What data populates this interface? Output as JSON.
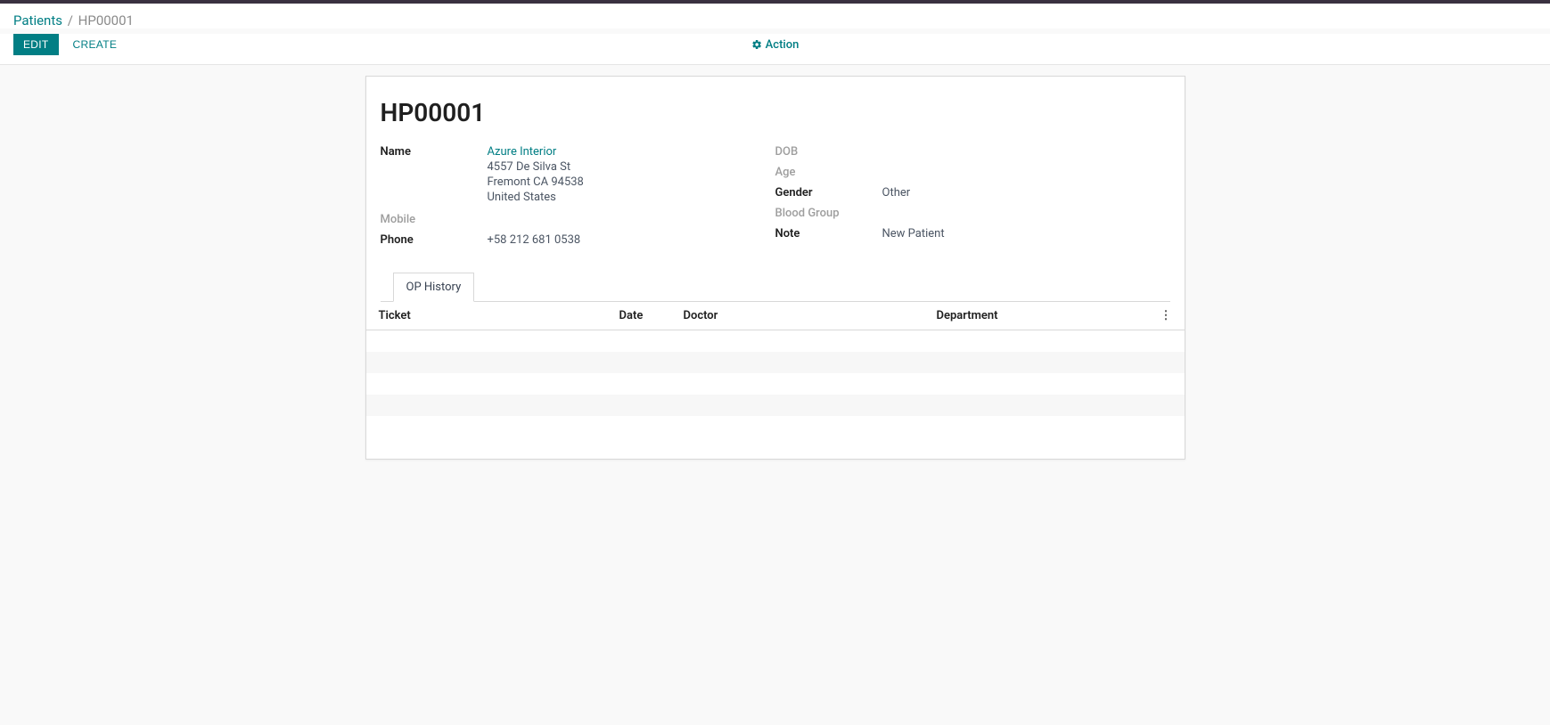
{
  "breadcrumb": {
    "root": "Patients",
    "separator": "/",
    "current": "HP00001"
  },
  "toolbar": {
    "edit_label": "EDIT",
    "create_label": "CREATE",
    "action_label": "Action"
  },
  "record": {
    "title": "HP00001",
    "left": {
      "name_label": "Name",
      "name_value": "Azure Interior",
      "address_line1": "4557 De Silva St",
      "address_line2": "Fremont CA 94538",
      "address_line3": "United States",
      "mobile_label": "Mobile",
      "mobile_value": "",
      "phone_label": "Phone",
      "phone_value": "+58 212 681 0538"
    },
    "right": {
      "dob_label": "DOB",
      "dob_value": "",
      "age_label": "Age",
      "age_value": "",
      "gender_label": "Gender",
      "gender_value": "Other",
      "blood_group_label": "Blood Group",
      "blood_group_value": "",
      "note_label": "Note",
      "note_value": "New Patient"
    }
  },
  "tabs": {
    "op_history": "OP History"
  },
  "table": {
    "columns": {
      "ticket": "Ticket",
      "date": "Date",
      "doctor": "Doctor",
      "department": "Department"
    },
    "menu_icon": "⋮"
  }
}
